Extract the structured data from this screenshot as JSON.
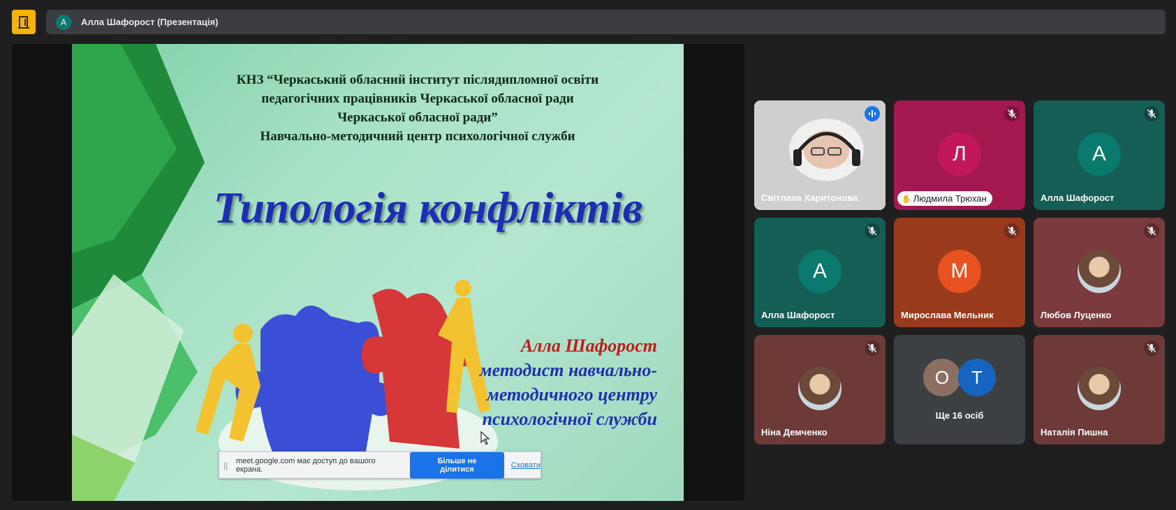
{
  "app": {
    "logo_icon": "meet-door-icon",
    "accent": "#f4b400"
  },
  "header": {
    "avatar_letter": "А",
    "title": "Алла Шафорост (Презентація)"
  },
  "slide": {
    "header_lines": [
      "КНЗ “Черкаський обласний інститут післядипломної освіти",
      "педагогічних працівників Черкаської обласної ради",
      "Черкаської обласної ради”",
      "Навчально-методичний центр психологічної служби"
    ],
    "title": "Типологія конфліктів",
    "author_name": "Алла Шафорост",
    "author_role_lines": [
      "методист навчально-",
      "методичного центру",
      "психологічної служби"
    ]
  },
  "share_banner": {
    "message": "meet.google.com має доступ до вашого екрана.",
    "stop_label": "Більше не ділитися",
    "hide_label": "Сховати"
  },
  "participants": [
    {
      "name": "Світлана Харитонова",
      "type": "video",
      "speaking": true,
      "bg": "#d8d8d8"
    },
    {
      "name": "Людмила Трюхан",
      "type": "letter",
      "letter": "Л",
      "muted": true,
      "hand_raised": true,
      "bg": "#a3184f",
      "avatar_bg": "#c2185b"
    },
    {
      "name": "Алла Шафорост",
      "type": "letter",
      "letter": "А",
      "muted": true,
      "bg": "#155e56",
      "avatar_bg": "#0b7a6e"
    },
    {
      "name": "Алла Шафорост",
      "type": "letter",
      "letter": "А",
      "muted": true,
      "bg": "#155e56",
      "avatar_bg": "#0b7a6e"
    },
    {
      "name": "Мирослава Мельник",
      "type": "letter",
      "letter": "М",
      "muted": true,
      "bg": "#9a3a1c",
      "avatar_bg": "#e8521f"
    },
    {
      "name": "Любов Луценко",
      "type": "photo",
      "muted": true,
      "bg": "#7a3a3e"
    },
    {
      "name": "Ніна Демченко",
      "type": "photo",
      "muted": true,
      "bg": "#6e3a38"
    },
    {
      "name": "Ще 16 осіб",
      "type": "more",
      "letters": [
        "О",
        "Т"
      ],
      "bg": "#3c4043"
    },
    {
      "name": "Наталія Пишна",
      "type": "photo",
      "muted": true,
      "bg": "#6e3a38"
    }
  ]
}
